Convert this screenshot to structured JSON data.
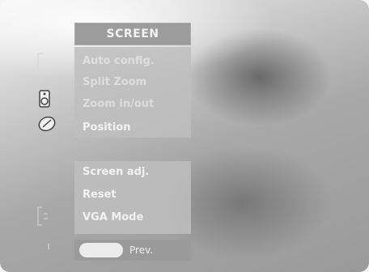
{
  "menu": {
    "title": "SCREEN",
    "items": [
      {
        "label": "Auto config.",
        "state": "dimmed"
      },
      {
        "label": "Split Zoom",
        "state": "dimmed"
      },
      {
        "label": "Zoom in/out",
        "state": "dimmed"
      },
      {
        "label": "Position",
        "state": "normal"
      }
    ],
    "items_lower": [
      {
        "label": "Screen adj.",
        "state": "normal"
      },
      {
        "label": "Reset",
        "state": "normal"
      },
      {
        "label": "VGA Mode",
        "state": "normal"
      }
    ]
  },
  "footer": {
    "prev_label": "Prev."
  },
  "icons": [
    "picture-icon",
    "sound-icon",
    "setup-icon",
    "screen-icon",
    "input-icon",
    "lock-icon"
  ],
  "colors": {
    "panel": "#bebebe",
    "title_bg": "#9c9c9c",
    "text": "#f2f2f2"
  }
}
